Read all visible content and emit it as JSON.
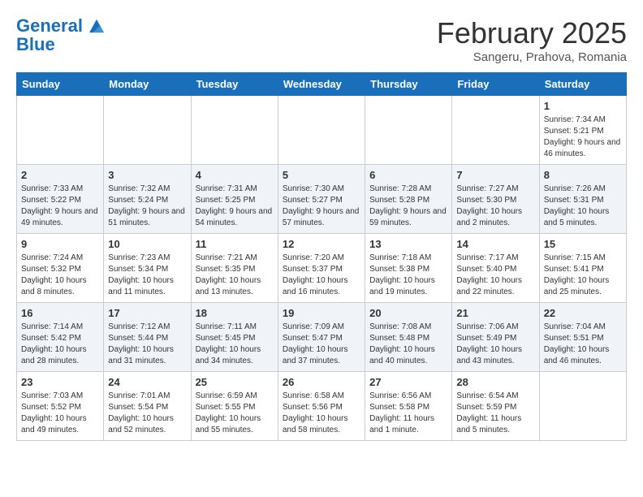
{
  "header": {
    "logo_line1": "General",
    "logo_line2": "Blue",
    "month": "February 2025",
    "location": "Sangeru, Prahova, Romania"
  },
  "days_of_week": [
    "Sunday",
    "Monday",
    "Tuesday",
    "Wednesday",
    "Thursday",
    "Friday",
    "Saturday"
  ],
  "weeks": [
    [
      {
        "day": "",
        "info": ""
      },
      {
        "day": "",
        "info": ""
      },
      {
        "day": "",
        "info": ""
      },
      {
        "day": "",
        "info": ""
      },
      {
        "day": "",
        "info": ""
      },
      {
        "day": "",
        "info": ""
      },
      {
        "day": "1",
        "info": "Sunrise: 7:34 AM\nSunset: 5:21 PM\nDaylight: 9 hours and 46 minutes."
      }
    ],
    [
      {
        "day": "2",
        "info": "Sunrise: 7:33 AM\nSunset: 5:22 PM\nDaylight: 9 hours and 49 minutes."
      },
      {
        "day": "3",
        "info": "Sunrise: 7:32 AM\nSunset: 5:24 PM\nDaylight: 9 hours and 51 minutes."
      },
      {
        "day": "4",
        "info": "Sunrise: 7:31 AM\nSunset: 5:25 PM\nDaylight: 9 hours and 54 minutes."
      },
      {
        "day": "5",
        "info": "Sunrise: 7:30 AM\nSunset: 5:27 PM\nDaylight: 9 hours and 57 minutes."
      },
      {
        "day": "6",
        "info": "Sunrise: 7:28 AM\nSunset: 5:28 PM\nDaylight: 9 hours and 59 minutes."
      },
      {
        "day": "7",
        "info": "Sunrise: 7:27 AM\nSunset: 5:30 PM\nDaylight: 10 hours and 2 minutes."
      },
      {
        "day": "8",
        "info": "Sunrise: 7:26 AM\nSunset: 5:31 PM\nDaylight: 10 hours and 5 minutes."
      }
    ],
    [
      {
        "day": "9",
        "info": "Sunrise: 7:24 AM\nSunset: 5:32 PM\nDaylight: 10 hours and 8 minutes."
      },
      {
        "day": "10",
        "info": "Sunrise: 7:23 AM\nSunset: 5:34 PM\nDaylight: 10 hours and 11 minutes."
      },
      {
        "day": "11",
        "info": "Sunrise: 7:21 AM\nSunset: 5:35 PM\nDaylight: 10 hours and 13 minutes."
      },
      {
        "day": "12",
        "info": "Sunrise: 7:20 AM\nSunset: 5:37 PM\nDaylight: 10 hours and 16 minutes."
      },
      {
        "day": "13",
        "info": "Sunrise: 7:18 AM\nSunset: 5:38 PM\nDaylight: 10 hours and 19 minutes."
      },
      {
        "day": "14",
        "info": "Sunrise: 7:17 AM\nSunset: 5:40 PM\nDaylight: 10 hours and 22 minutes."
      },
      {
        "day": "15",
        "info": "Sunrise: 7:15 AM\nSunset: 5:41 PM\nDaylight: 10 hours and 25 minutes."
      }
    ],
    [
      {
        "day": "16",
        "info": "Sunrise: 7:14 AM\nSunset: 5:42 PM\nDaylight: 10 hours and 28 minutes."
      },
      {
        "day": "17",
        "info": "Sunrise: 7:12 AM\nSunset: 5:44 PM\nDaylight: 10 hours and 31 minutes."
      },
      {
        "day": "18",
        "info": "Sunrise: 7:11 AM\nSunset: 5:45 PM\nDaylight: 10 hours and 34 minutes."
      },
      {
        "day": "19",
        "info": "Sunrise: 7:09 AM\nSunset: 5:47 PM\nDaylight: 10 hours and 37 minutes."
      },
      {
        "day": "20",
        "info": "Sunrise: 7:08 AM\nSunset: 5:48 PM\nDaylight: 10 hours and 40 minutes."
      },
      {
        "day": "21",
        "info": "Sunrise: 7:06 AM\nSunset: 5:49 PM\nDaylight: 10 hours and 43 minutes."
      },
      {
        "day": "22",
        "info": "Sunrise: 7:04 AM\nSunset: 5:51 PM\nDaylight: 10 hours and 46 minutes."
      }
    ],
    [
      {
        "day": "23",
        "info": "Sunrise: 7:03 AM\nSunset: 5:52 PM\nDaylight: 10 hours and 49 minutes."
      },
      {
        "day": "24",
        "info": "Sunrise: 7:01 AM\nSunset: 5:54 PM\nDaylight: 10 hours and 52 minutes."
      },
      {
        "day": "25",
        "info": "Sunrise: 6:59 AM\nSunset: 5:55 PM\nDaylight: 10 hours and 55 minutes."
      },
      {
        "day": "26",
        "info": "Sunrise: 6:58 AM\nSunset: 5:56 PM\nDaylight: 10 hours and 58 minutes."
      },
      {
        "day": "27",
        "info": "Sunrise: 6:56 AM\nSunset: 5:58 PM\nDaylight: 11 hours and 1 minute."
      },
      {
        "day": "28",
        "info": "Sunrise: 6:54 AM\nSunset: 5:59 PM\nDaylight: 11 hours and 5 minutes."
      },
      {
        "day": "",
        "info": ""
      }
    ]
  ]
}
